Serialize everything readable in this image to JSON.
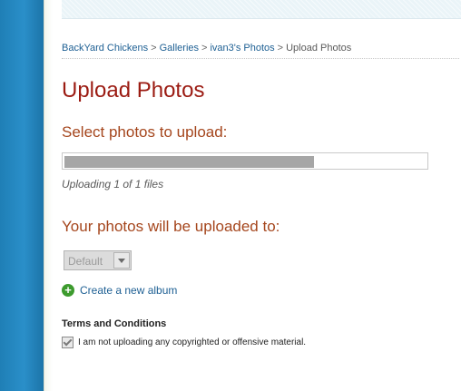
{
  "breadcrumb": {
    "items": [
      "BackYard Chickens",
      "Galleries",
      "ivan3's Photos"
    ],
    "current": "Upload Photos",
    "separator": ">"
  },
  "page_title": "Upload Photos",
  "select_section": {
    "heading": "Select photos to upload:",
    "progress_fraction": 0.69,
    "status": "Uploading 1 of 1 files"
  },
  "destination_section": {
    "heading": "Your photos will be uploaded to:",
    "album_value": "Default",
    "create_album_label": "Create a new album"
  },
  "terms": {
    "heading": "Terms and Conditions",
    "checked": true,
    "agreement_text": "I am not uploading any copyrighted or offensive material."
  },
  "colors": {
    "title": "#9b1b12",
    "section_heading": "#a5461d",
    "link": "#1d5f93",
    "rail": "#2a8fc9",
    "progress_fill": "#a6a6a6",
    "add_icon": "#3d9b2e"
  },
  "icons": {
    "create_album": "plus-circle-icon",
    "dropdown": "chevron-down-icon",
    "checkbox": "checkmark-icon"
  }
}
